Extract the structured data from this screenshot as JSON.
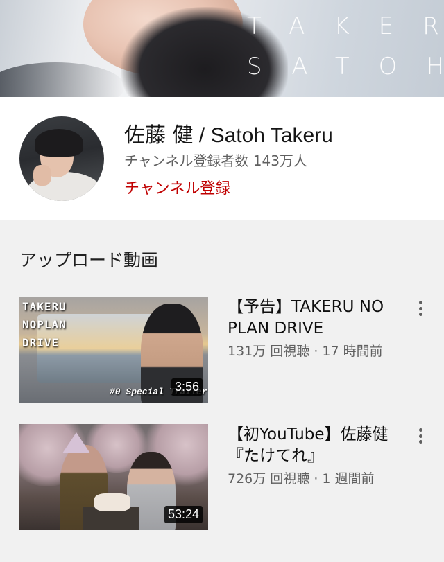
{
  "banner": {
    "line1": "TAKERU",
    "line2": "SATOH"
  },
  "channel": {
    "name_jp": "佐藤 健",
    "name_sep": " / ",
    "name_en": "Satoh Takeru",
    "subscribers": "チャンネル登録者数 143万人",
    "subscribe_label": "チャンネル登録"
  },
  "section": {
    "title": "アップロード動画"
  },
  "videos": [
    {
      "title": "【予告】TAKERU NO PLAN DRIVE",
      "meta": "131万 回視聴 · 17 時間前",
      "duration": "3:56",
      "thumb_lines": [
        "TAKERU",
        "NOPLAN",
        "DRIVE"
      ],
      "thumb_caption": "#0 Special Trailer"
    },
    {
      "title": "【初YouTube】佐藤健『たけてれ』",
      "meta": "726万 回視聴 · 1 週間前",
      "duration": "53:24"
    }
  ],
  "colors": {
    "subscribe": "#c00000",
    "meta": "#606060",
    "background": "#f1f1f1"
  },
  "icons": {
    "more": "more-vert-icon"
  }
}
